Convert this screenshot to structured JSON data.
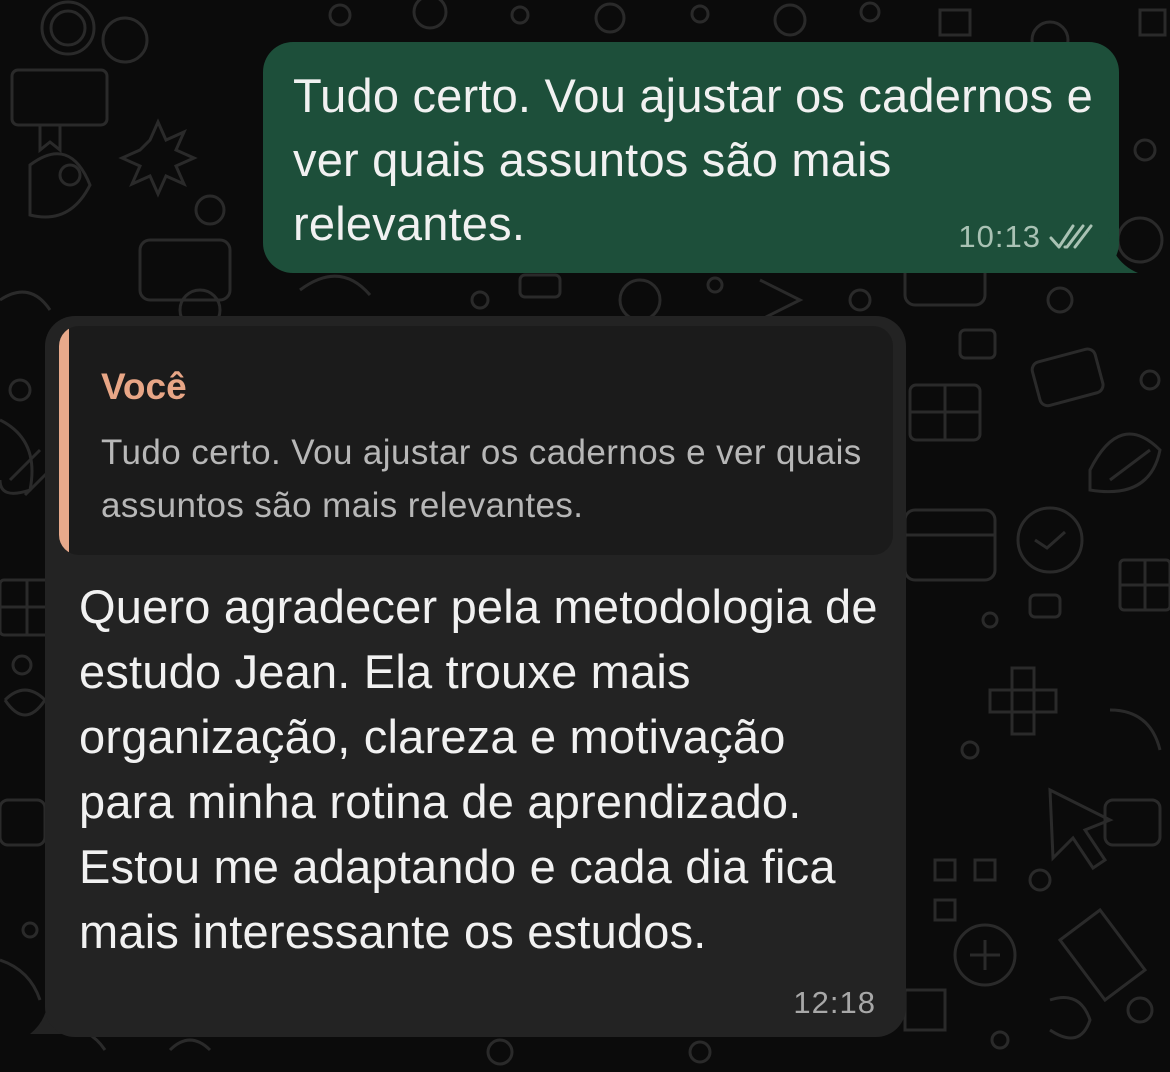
{
  "outgoing_message": {
    "text": "Tudo certo. Vou ajustar os cadernos e ver quais assuntos são mais relevantes.",
    "time": "10:13",
    "status_icon": "double-check-icon",
    "bubble_color": "#1d4f3a"
  },
  "incoming_message": {
    "quote": {
      "author": "Você",
      "text": "Tudo certo. Vou ajustar os cadernos e ver quais assuntos são mais relevantes.",
      "accent_color": "#e7a98b"
    },
    "text": "Quero agradecer pela metodologia de estudo Jean. Ela trouxe mais organização, clareza e motivação para minha rotina de aprendizado. Estou me adaptando e cada dia fica mais interessante os estudos.",
    "time": "12:18",
    "bubble_color": "#232323"
  },
  "background": {
    "color": "#0b0b0b",
    "pattern": "doodle-wallpaper"
  }
}
